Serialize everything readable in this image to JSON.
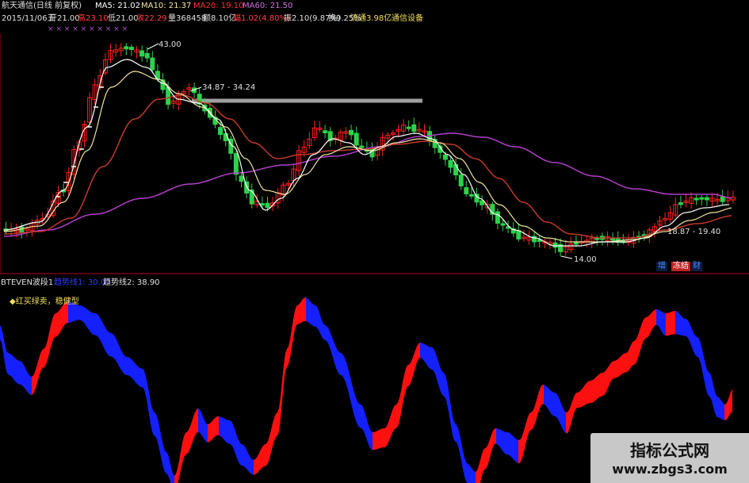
{
  "header": {
    "stock_name": "航天通信(日线 前复权)",
    "ma5": "MA5: 21.02",
    "ma10": "MA10: 21.37",
    "ma20": "MA20: 19.10",
    "ma60": "MA60: 21.50",
    "date": "2015/11/06五",
    "open": "开21.00",
    "high": "高23.10",
    "low": "低21.00",
    "close": "收22.29",
    "volume": "量368458",
    "amount": "额8.10亿",
    "change": "幅1.02(4.80%)",
    "amplitude": "振2.10(9.87%)",
    "turnover": "换9.25%",
    "float": "流通3.98亿",
    "settings": "通信设备"
  },
  "markers": {
    "top_row": "× × ×    ×    ×         × × ×  ×  ×",
    "peak_label": "43.00",
    "range_label_1": "34.87 - 34.24",
    "low_label": "14.00",
    "range_label_2": "18.87 - 19.40",
    "badge_1": "增",
    "badge_2": "冻结",
    "badge_3": "财"
  },
  "indicator": {
    "title": "BTEVEN波段1",
    "line1": "趋势线1: 30.07",
    "line2": "趋势线2: 38.90",
    "legend": "红买绿卖，稳健型"
  },
  "watermark": {
    "title": "指标公式网",
    "url": "www.zbgs3.com"
  },
  "colors": {
    "up": "#ff2020",
    "down": "#2dd24b",
    "ma5": "#ffffff",
    "ma10": "#f2e6a0",
    "ma20": "#c0392b",
    "ma60": "#b040c8",
    "red_band": "#ff1010",
    "blue_band": "#1520ff",
    "divider": "#b00020",
    "resistance": "#a0a0a0"
  },
  "chart_data": [
    {
      "type": "candlestick",
      "title": "航天通信(日线 前复权)",
      "annotations": [
        "43.00",
        "34.87 - 34.24",
        "14.00",
        "18.87 - 19.40"
      ],
      "series": [
        {
          "name": "MA5",
          "value": 21.02
        },
        {
          "name": "MA10",
          "value": 21.37
        },
        {
          "name": "MA20",
          "value": 19.1
        },
        {
          "name": "MA60",
          "value": 21.5
        }
      ]
    },
    {
      "type": "area",
      "title": "BTEVEN波段1",
      "series": [
        {
          "name": "趋势线1",
          "value": 30.07
        },
        {
          "name": "趋势线2",
          "value": 38.9
        }
      ]
    }
  ]
}
